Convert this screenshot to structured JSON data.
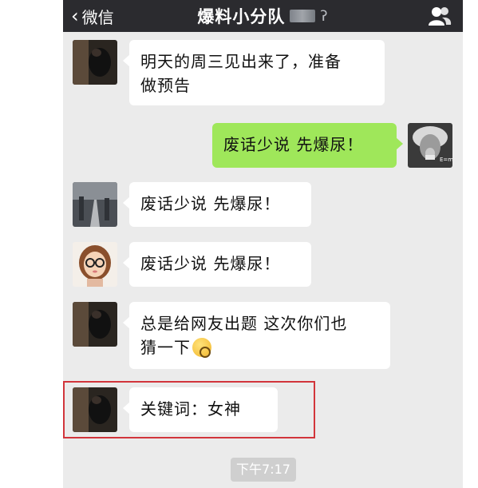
{
  "header": {
    "back_label": "微信",
    "title": "爆料小分队"
  },
  "messages": [
    {
      "side": "left",
      "avatar": "dark-photo-avatar",
      "text_lines": [
        "明天的周三见出来了，准备",
        "做预告"
      ]
    },
    {
      "side": "right",
      "avatar": "einstein-avatar",
      "text_lines": [
        "废话少说 先爆尿！"
      ]
    },
    {
      "side": "left",
      "avatar": "road-photo-avatar",
      "text_lines": [
        "废话少说 先爆尿！"
      ]
    },
    {
      "side": "left",
      "avatar": "cartoon-girl-avatar",
      "text_lines": [
        "废话少说 先爆尿！"
      ]
    },
    {
      "side": "left",
      "avatar": "dark-photo-avatar",
      "text_lines": [
        "总是给网友出题 这次你们也",
        "猜一下"
      ],
      "emoji": "thinking-emoji"
    },
    {
      "side": "left",
      "avatar": "dark-photo-avatar",
      "text_lines": [
        "关键词：女神"
      ],
      "highlighted": true
    }
  ],
  "timestamp": "下午7:17",
  "colors": {
    "header_bg": "#2b2b2f",
    "chat_bg": "#ebebeb",
    "sent_bubble": "#9fe75a",
    "received_bubble": "#ffffff",
    "highlight_border": "#d2353b"
  }
}
